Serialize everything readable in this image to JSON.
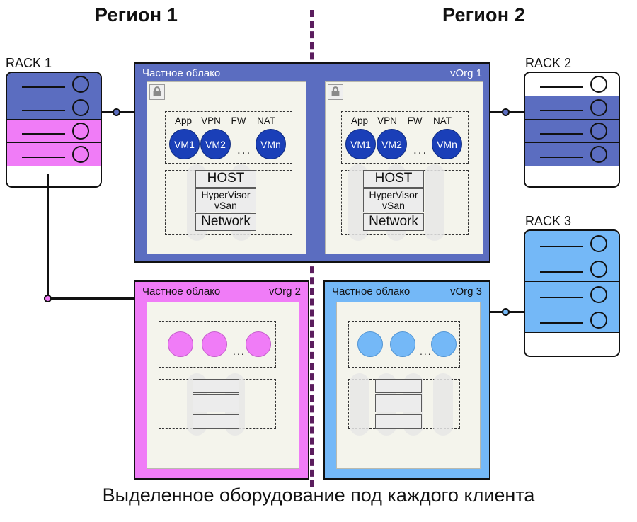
{
  "diagram": {
    "caption": "Выделенное оборудование под каждого клиента",
    "regions": [
      {
        "id": "region-1",
        "label": "Регион 1"
      },
      {
        "id": "region-2",
        "label": "Регион 2"
      }
    ],
    "divider_color": "#5b1d5e"
  },
  "racks": [
    {
      "id": "rack-1",
      "label": "RACK 1",
      "units": [
        "blue",
        "blue",
        "magenta",
        "magenta",
        "base"
      ]
    },
    {
      "id": "rack-2",
      "label": "RACK 2",
      "units": [
        "white",
        "blue",
        "blue",
        "blue",
        "base"
      ]
    },
    {
      "id": "rack-3",
      "label": "RACK 3",
      "units": [
        "lightblue",
        "lightblue",
        "lightblue",
        "lightblue",
        "base"
      ]
    }
  ],
  "clouds": {
    "top": {
      "title": "Частное облако",
      "org": "vOrg 1",
      "color": "#5b6dc0",
      "panels": [
        {
          "id": "panel-a",
          "lock": true,
          "services": [
            "App",
            "VPN",
            "FW",
            "NAT"
          ],
          "vms": [
            "VM1",
            "VM2",
            "VMn"
          ],
          "ellipsis": "...",
          "stack": [
            "HOST",
            "HyperVisor\nvSan",
            "Network"
          ],
          "stack_lines": {
            "host": "HOST",
            "hyper_1": "HyperVisor",
            "hyper_2": "vSan",
            "network": "Network"
          }
        },
        {
          "id": "panel-b",
          "lock": true,
          "services": [
            "App",
            "VPN",
            "FW",
            "NAT"
          ],
          "vms": [
            "VM1",
            "VM2",
            "VMn"
          ],
          "ellipsis": "...",
          "stack_lines": {
            "host": "HOST",
            "hyper_1": "HyperVisor",
            "hyper_2": "vSan",
            "network": "Network"
          }
        }
      ]
    },
    "vorg2": {
      "title": "Частное облако",
      "org": "vOrg 2",
      "color": "#f07cf7",
      "circles": 3,
      "ellipsis": "...",
      "stack_rows": 3
    },
    "vorg3": {
      "title": "Частное облако",
      "org": "vOrg 3",
      "color": "#74b8f7",
      "circles": 3,
      "ellipsis": "...",
      "stack_rows": 3
    }
  },
  "connectors": [
    {
      "id": "rack1-to-vorg1",
      "color": "#5b6dc0"
    },
    {
      "id": "rack1-to-vorg2",
      "color": "#f07cf7"
    },
    {
      "id": "rack2-to-vorg1",
      "color": "#5b6dc0"
    },
    {
      "id": "rack3-to-vorg3",
      "color": "#74b8f7"
    }
  ]
}
